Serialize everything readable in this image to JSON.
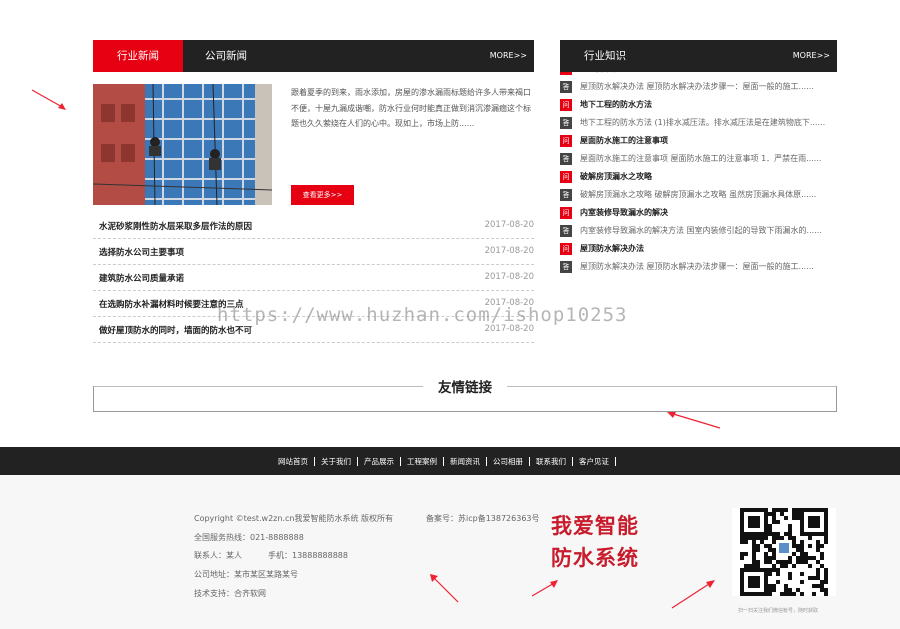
{
  "news": {
    "tabs": [
      "行业新闻",
      "公司新闻"
    ],
    "more": "MORE>>",
    "feature_text": "跟着夏季的到来，雨水添加，房屋的渗水漏雨标题给许多人带来褐口不便，十屋九漏成谐嘲，防水行业何时能真正做到消沉渗漏痼这个标题也久久萦绕在人们的心中。现如上，市场上防......",
    "detail_button": "查看更多>>",
    "items": [
      {
        "title": "水泥砂浆刚性防水层采取多层作法的原因",
        "date": "2017-08-20"
      },
      {
        "title": "选择防水公司主要事项",
        "date": "2017-08-20"
      },
      {
        "title": "建筑防水公司质量承诺",
        "date": "2017-08-20"
      },
      {
        "title": "在选购防水补漏材料时候要注意的三点",
        "date": "2017-08-20"
      },
      {
        "title": "做好屋顶防水的同时，墙面的防水也不可",
        "date": "2017-08-20"
      }
    ]
  },
  "knowledge": {
    "tab": "行业知识",
    "more": "MORE>>",
    "badge_q": "问",
    "badge_a": "答",
    "rows": [
      {
        "type": "q",
        "text": "屋顶防水解决办法"
      },
      {
        "type": "a",
        "text": "屋顶防水解决办法 屋顶防水解决办法步骤一：屋面一般的施工......"
      },
      {
        "type": "q",
        "text": "地下工程的防水方法"
      },
      {
        "type": "a",
        "text": "地下工程的防水方法 (1)排水减压法。排水减压法是在建筑物底下......",
        "wrap": true
      },
      {
        "type": "q",
        "text": "屋面防水施工的注意事项"
      },
      {
        "type": "a",
        "text": "屋面防水施工的注意事项 屋面防水施工的注意事项 1．严禁在雨......",
        "wrap": true
      },
      {
        "type": "q",
        "text": "破解房顶漏水之攻略"
      },
      {
        "type": "a",
        "text": "破解房顶漏水之攻略 破解房顶漏水之攻略 虽然房顶漏水具体原......"
      },
      {
        "type": "q",
        "text": "内室装修导致漏水的解决"
      },
      {
        "type": "a",
        "text": "内室装修导致漏水的解决方法 国室内装修引起的导致下雨漏水的......",
        "wrap": true
      },
      {
        "type": "q",
        "text": "屋顶防水解决办法"
      },
      {
        "type": "a",
        "text": "屋顶防水解决办法 屋顶防水解决办法步骤一：屋面一般的施工......"
      }
    ]
  },
  "friend_links": {
    "title": "友情链接"
  },
  "footer_nav": [
    "网站首页",
    "关于我们",
    "产品展示",
    "工程案例",
    "新闻资讯",
    "公司相册",
    "联系我们",
    "客户见证"
  ],
  "footer": {
    "copyright": "Copyright ©test.w2zn.cn我爱智能防水系统 版权所有",
    "icp": "备案号：苏icp备138726363号",
    "hotline": "全国服务热线：021-8888888",
    "contact": "联系人：某人",
    "mobile": "手机：13888888888",
    "address": "公司地址：某市某区某路某号",
    "support": "技术支持：合齐软网",
    "brand_line1": "我爱智能",
    "brand_line2": "防水系统",
    "qr_caption": "扫一扫关注我们微信帐号，随时获取"
  },
  "watermark": "https://www.huzhan.com/ishop10253",
  "colors": {
    "accent": "#e60012",
    "dark": "#222222",
    "brand_red": "#c81c2c"
  }
}
